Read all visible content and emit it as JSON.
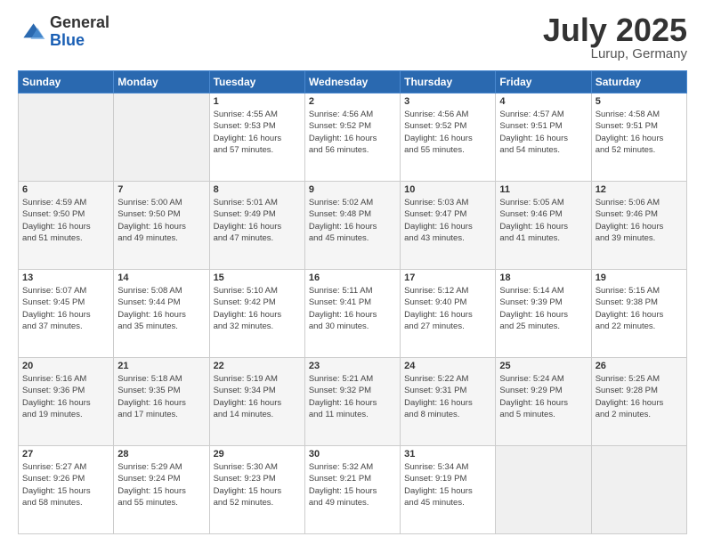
{
  "logo": {
    "general": "General",
    "blue": "Blue"
  },
  "title": "July 2025",
  "location": "Lurup, Germany",
  "days_header": [
    "Sunday",
    "Monday",
    "Tuesday",
    "Wednesday",
    "Thursday",
    "Friday",
    "Saturday"
  ],
  "weeks": [
    [
      {
        "day": "",
        "info": ""
      },
      {
        "day": "",
        "info": ""
      },
      {
        "day": "1",
        "info": "Sunrise: 4:55 AM\nSunset: 9:53 PM\nDaylight: 16 hours\nand 57 minutes."
      },
      {
        "day": "2",
        "info": "Sunrise: 4:56 AM\nSunset: 9:52 PM\nDaylight: 16 hours\nand 56 minutes."
      },
      {
        "day": "3",
        "info": "Sunrise: 4:56 AM\nSunset: 9:52 PM\nDaylight: 16 hours\nand 55 minutes."
      },
      {
        "day": "4",
        "info": "Sunrise: 4:57 AM\nSunset: 9:51 PM\nDaylight: 16 hours\nand 54 minutes."
      },
      {
        "day": "5",
        "info": "Sunrise: 4:58 AM\nSunset: 9:51 PM\nDaylight: 16 hours\nand 52 minutes."
      }
    ],
    [
      {
        "day": "6",
        "info": "Sunrise: 4:59 AM\nSunset: 9:50 PM\nDaylight: 16 hours\nand 51 minutes."
      },
      {
        "day": "7",
        "info": "Sunrise: 5:00 AM\nSunset: 9:50 PM\nDaylight: 16 hours\nand 49 minutes."
      },
      {
        "day": "8",
        "info": "Sunrise: 5:01 AM\nSunset: 9:49 PM\nDaylight: 16 hours\nand 47 minutes."
      },
      {
        "day": "9",
        "info": "Sunrise: 5:02 AM\nSunset: 9:48 PM\nDaylight: 16 hours\nand 45 minutes."
      },
      {
        "day": "10",
        "info": "Sunrise: 5:03 AM\nSunset: 9:47 PM\nDaylight: 16 hours\nand 43 minutes."
      },
      {
        "day": "11",
        "info": "Sunrise: 5:05 AM\nSunset: 9:46 PM\nDaylight: 16 hours\nand 41 minutes."
      },
      {
        "day": "12",
        "info": "Sunrise: 5:06 AM\nSunset: 9:46 PM\nDaylight: 16 hours\nand 39 minutes."
      }
    ],
    [
      {
        "day": "13",
        "info": "Sunrise: 5:07 AM\nSunset: 9:45 PM\nDaylight: 16 hours\nand 37 minutes."
      },
      {
        "day": "14",
        "info": "Sunrise: 5:08 AM\nSunset: 9:44 PM\nDaylight: 16 hours\nand 35 minutes."
      },
      {
        "day": "15",
        "info": "Sunrise: 5:10 AM\nSunset: 9:42 PM\nDaylight: 16 hours\nand 32 minutes."
      },
      {
        "day": "16",
        "info": "Sunrise: 5:11 AM\nSunset: 9:41 PM\nDaylight: 16 hours\nand 30 minutes."
      },
      {
        "day": "17",
        "info": "Sunrise: 5:12 AM\nSunset: 9:40 PM\nDaylight: 16 hours\nand 27 minutes."
      },
      {
        "day": "18",
        "info": "Sunrise: 5:14 AM\nSunset: 9:39 PM\nDaylight: 16 hours\nand 25 minutes."
      },
      {
        "day": "19",
        "info": "Sunrise: 5:15 AM\nSunset: 9:38 PM\nDaylight: 16 hours\nand 22 minutes."
      }
    ],
    [
      {
        "day": "20",
        "info": "Sunrise: 5:16 AM\nSunset: 9:36 PM\nDaylight: 16 hours\nand 19 minutes."
      },
      {
        "day": "21",
        "info": "Sunrise: 5:18 AM\nSunset: 9:35 PM\nDaylight: 16 hours\nand 17 minutes."
      },
      {
        "day": "22",
        "info": "Sunrise: 5:19 AM\nSunset: 9:34 PM\nDaylight: 16 hours\nand 14 minutes."
      },
      {
        "day": "23",
        "info": "Sunrise: 5:21 AM\nSunset: 9:32 PM\nDaylight: 16 hours\nand 11 minutes."
      },
      {
        "day": "24",
        "info": "Sunrise: 5:22 AM\nSunset: 9:31 PM\nDaylight: 16 hours\nand 8 minutes."
      },
      {
        "day": "25",
        "info": "Sunrise: 5:24 AM\nSunset: 9:29 PM\nDaylight: 16 hours\nand 5 minutes."
      },
      {
        "day": "26",
        "info": "Sunrise: 5:25 AM\nSunset: 9:28 PM\nDaylight: 16 hours\nand 2 minutes."
      }
    ],
    [
      {
        "day": "27",
        "info": "Sunrise: 5:27 AM\nSunset: 9:26 PM\nDaylight: 15 hours\nand 58 minutes."
      },
      {
        "day": "28",
        "info": "Sunrise: 5:29 AM\nSunset: 9:24 PM\nDaylight: 15 hours\nand 55 minutes."
      },
      {
        "day": "29",
        "info": "Sunrise: 5:30 AM\nSunset: 9:23 PM\nDaylight: 15 hours\nand 52 minutes."
      },
      {
        "day": "30",
        "info": "Sunrise: 5:32 AM\nSunset: 9:21 PM\nDaylight: 15 hours\nand 49 minutes."
      },
      {
        "day": "31",
        "info": "Sunrise: 5:34 AM\nSunset: 9:19 PM\nDaylight: 15 hours\nand 45 minutes."
      },
      {
        "day": "",
        "info": ""
      },
      {
        "day": "",
        "info": ""
      }
    ]
  ]
}
